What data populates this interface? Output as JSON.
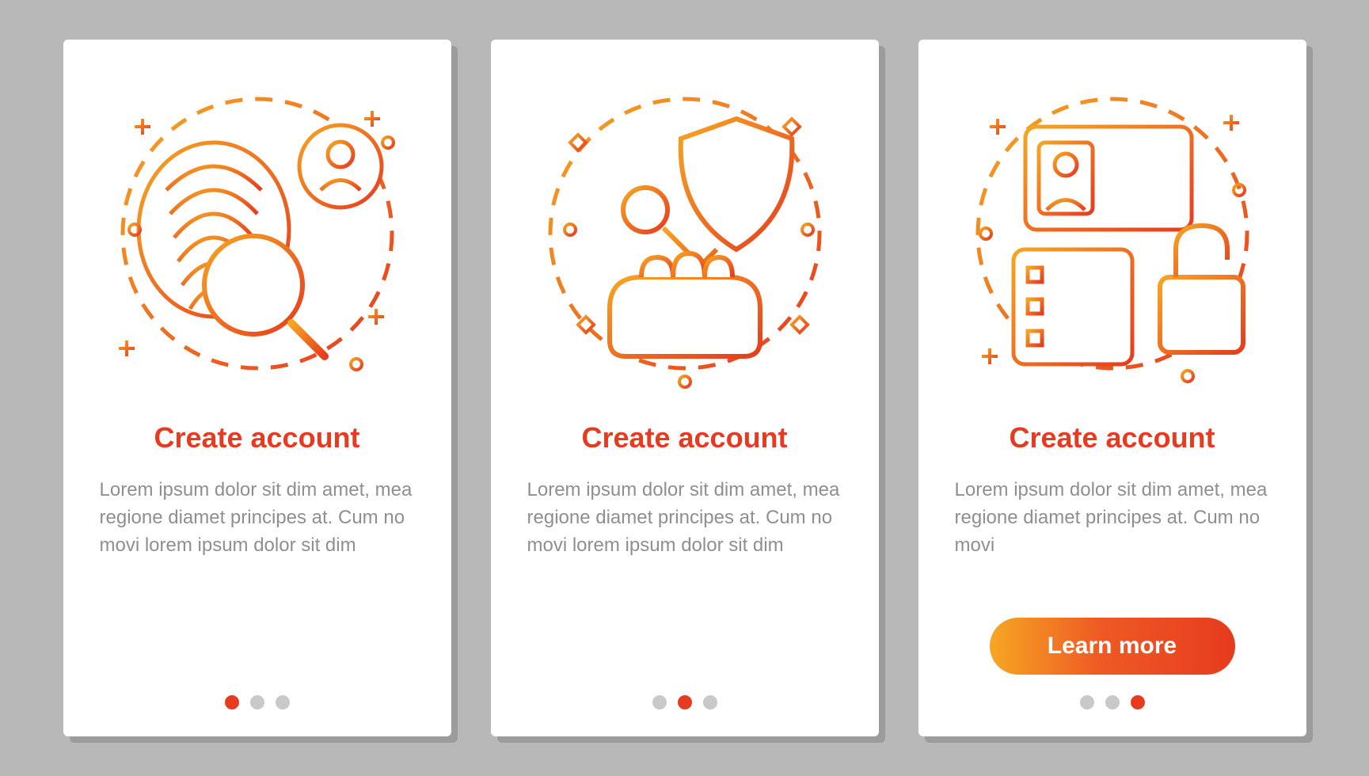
{
  "cards": [
    {
      "title": "Create account",
      "body": "Lorem ipsum dolor sit dim amet, mea regione diamet principes at. Cum no movi lorem ipsum dolor sit dim",
      "active_dot": 0,
      "dot_count": 3
    },
    {
      "title": "Create account",
      "body": "Lorem ipsum dolor sit dim amet, mea regione diamet principes at. Cum no movi lorem ipsum dolor sit dim",
      "active_dot": 1,
      "dot_count": 3
    },
    {
      "title": "Create account",
      "body": "Lorem ipsum dolor sit dim amet, mea regione diamet principes at. Cum no movi",
      "cta_label": "Learn more",
      "active_dot": 2,
      "dot_count": 3
    }
  ],
  "colors": {
    "accent": "#e63b1f",
    "accent_light": "#f6a623",
    "text_muted": "#8f8f8f",
    "dot_inactive": "#c9c9c9"
  },
  "icons": {
    "card0": "fingerprint-search-user",
    "card1": "hand-key-shield",
    "card2": "id-card-checklist-lock"
  }
}
